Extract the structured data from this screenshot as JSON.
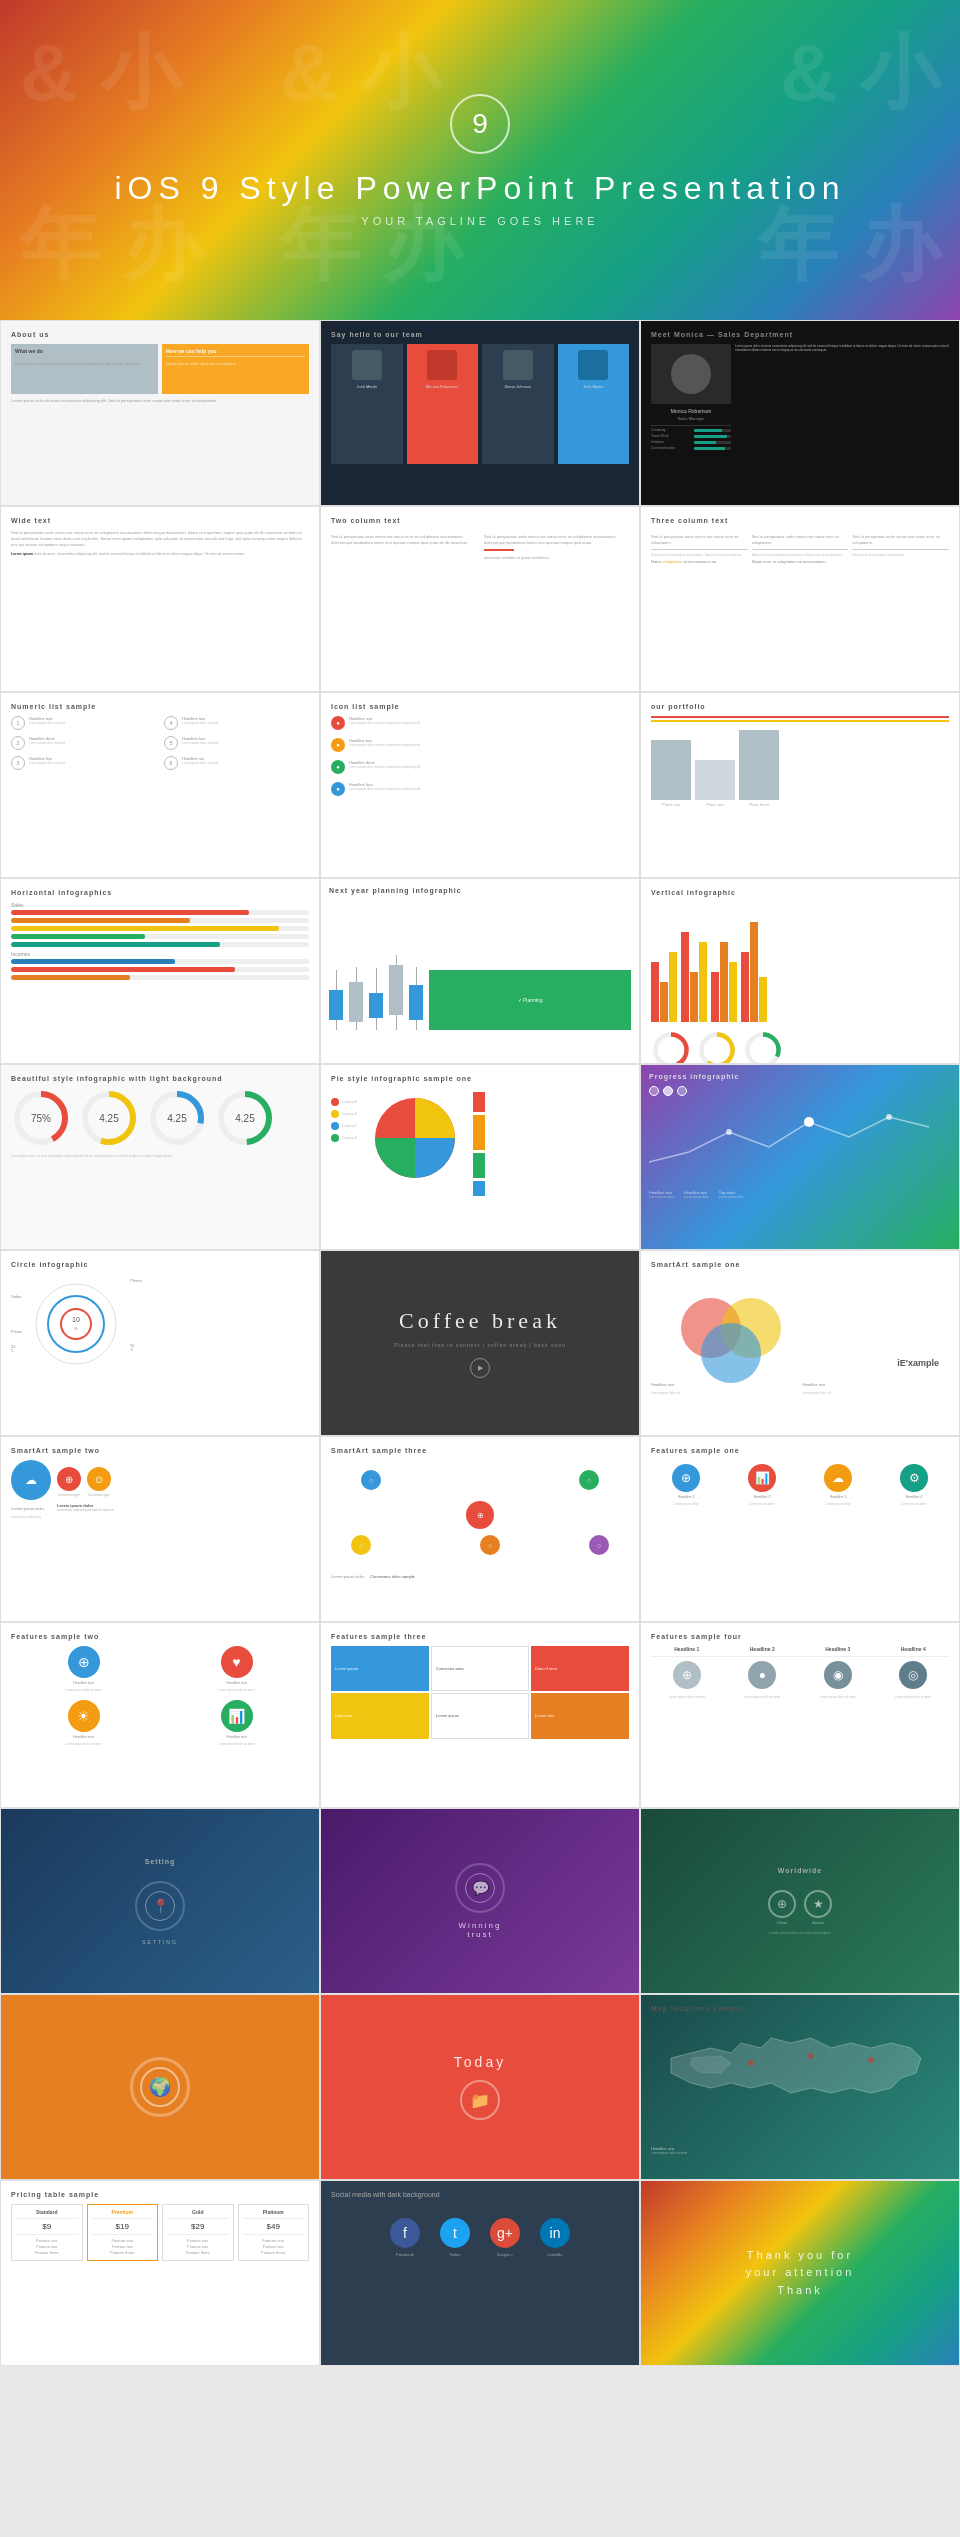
{
  "hero": {
    "number": "9",
    "title": "iOS  9  Style  PowerPoint  Presentation",
    "tagline": "YOUR TAGLINE GOES HERE"
  },
  "slides": [
    {
      "id": "about-us",
      "title": "About us",
      "type": "about"
    },
    {
      "id": "say-hello",
      "title": "Say hello to our team",
      "type": "team"
    },
    {
      "id": "meet-monica",
      "title": "Meet Monica — Sales Department",
      "type": "profile"
    },
    {
      "id": "wide-text",
      "title": "Wide text",
      "type": "wide-text"
    },
    {
      "id": "two-col-text",
      "title": "Two column text",
      "type": "two-col-text"
    },
    {
      "id": "three-col-text",
      "title": "Three column text",
      "type": "three-col-text"
    },
    {
      "id": "numeric-list",
      "title": "Numeric list sample",
      "type": "numeric-list"
    },
    {
      "id": "icon-list",
      "title": "Icon list sample",
      "type": "icon-list"
    },
    {
      "id": "portfolio",
      "title": "our portfolio",
      "type": "portfolio"
    },
    {
      "id": "horiz-info",
      "title": "Horizontal infographics",
      "type": "horiz-info"
    },
    {
      "id": "next-year",
      "title": "Next year planning infographic",
      "type": "next-year"
    },
    {
      "id": "vert-info",
      "title": "Vertical infographic",
      "type": "vert-info"
    },
    {
      "id": "donut-light",
      "title": "Beautiful style infographic with light background",
      "type": "donut-light"
    },
    {
      "id": "pie-style",
      "title": "Pie style infographic sample one",
      "type": "pie-style"
    },
    {
      "id": "progress-info",
      "title": "Progress infographic",
      "type": "progress-info"
    },
    {
      "id": "circle-info",
      "title": "Circle infographic",
      "type": "circle-info"
    },
    {
      "id": "coffee-break",
      "title": "",
      "type": "coffee-break"
    },
    {
      "id": "smartart-one",
      "title": "SmartArt sample one",
      "type": "smartart-one"
    },
    {
      "id": "smartart-two",
      "title": "SmartArt sample two",
      "type": "smartart-two"
    },
    {
      "id": "smartart-three",
      "title": "SmartArt sample three",
      "type": "smartart-three"
    },
    {
      "id": "features-one",
      "title": "Features sample one",
      "type": "features-one"
    },
    {
      "id": "features-two",
      "title": "Features sample two",
      "type": "features-two"
    },
    {
      "id": "features-three",
      "title": "Features sample three",
      "type": "features-three"
    },
    {
      "id": "features-four",
      "title": "Features sample four",
      "type": "features-four"
    },
    {
      "id": "setting",
      "title": "Setting",
      "type": "setting"
    },
    {
      "id": "winning",
      "title": "Winning trust",
      "type": "winning"
    },
    {
      "id": "worldwide",
      "title": "Worldwide",
      "type": "worldwide"
    },
    {
      "id": "orange-slide",
      "title": "",
      "type": "orange-slide"
    },
    {
      "id": "today-slide",
      "title": "Today",
      "type": "today-slide"
    },
    {
      "id": "map-slide",
      "title": "Map locations sample",
      "type": "map-slide"
    },
    {
      "id": "pricing-slide",
      "title": "Pricing table sample",
      "type": "pricing-slide"
    },
    {
      "id": "social-slide",
      "title": "Social media with dark background",
      "type": "social-slide"
    },
    {
      "id": "thankyou-slide",
      "title": "",
      "type": "thankyou-slide"
    }
  ],
  "coffee_break": {
    "title": "Coffee break",
    "subtitle": "Please feel free to connect | coffee break | back soon"
  },
  "thankyou": {
    "line1": "Thank you for",
    "line2": "your attention",
    "line3": "Thank"
  },
  "social": {
    "facebook": "Facebook",
    "twitter": "Twitter",
    "google": "Google +",
    "linkedin": "LinkedIn"
  },
  "pricing": {
    "cols": [
      "Standard",
      "Premium",
      "Gold",
      "Platinum"
    ]
  },
  "colors": {
    "red": "#e74c3c",
    "orange": "#e67e22",
    "yellow": "#f1c40f",
    "green": "#27ae60",
    "teal": "#16a085",
    "blue": "#2980b9",
    "purple": "#8e44ad",
    "dark": "#1a2633"
  }
}
